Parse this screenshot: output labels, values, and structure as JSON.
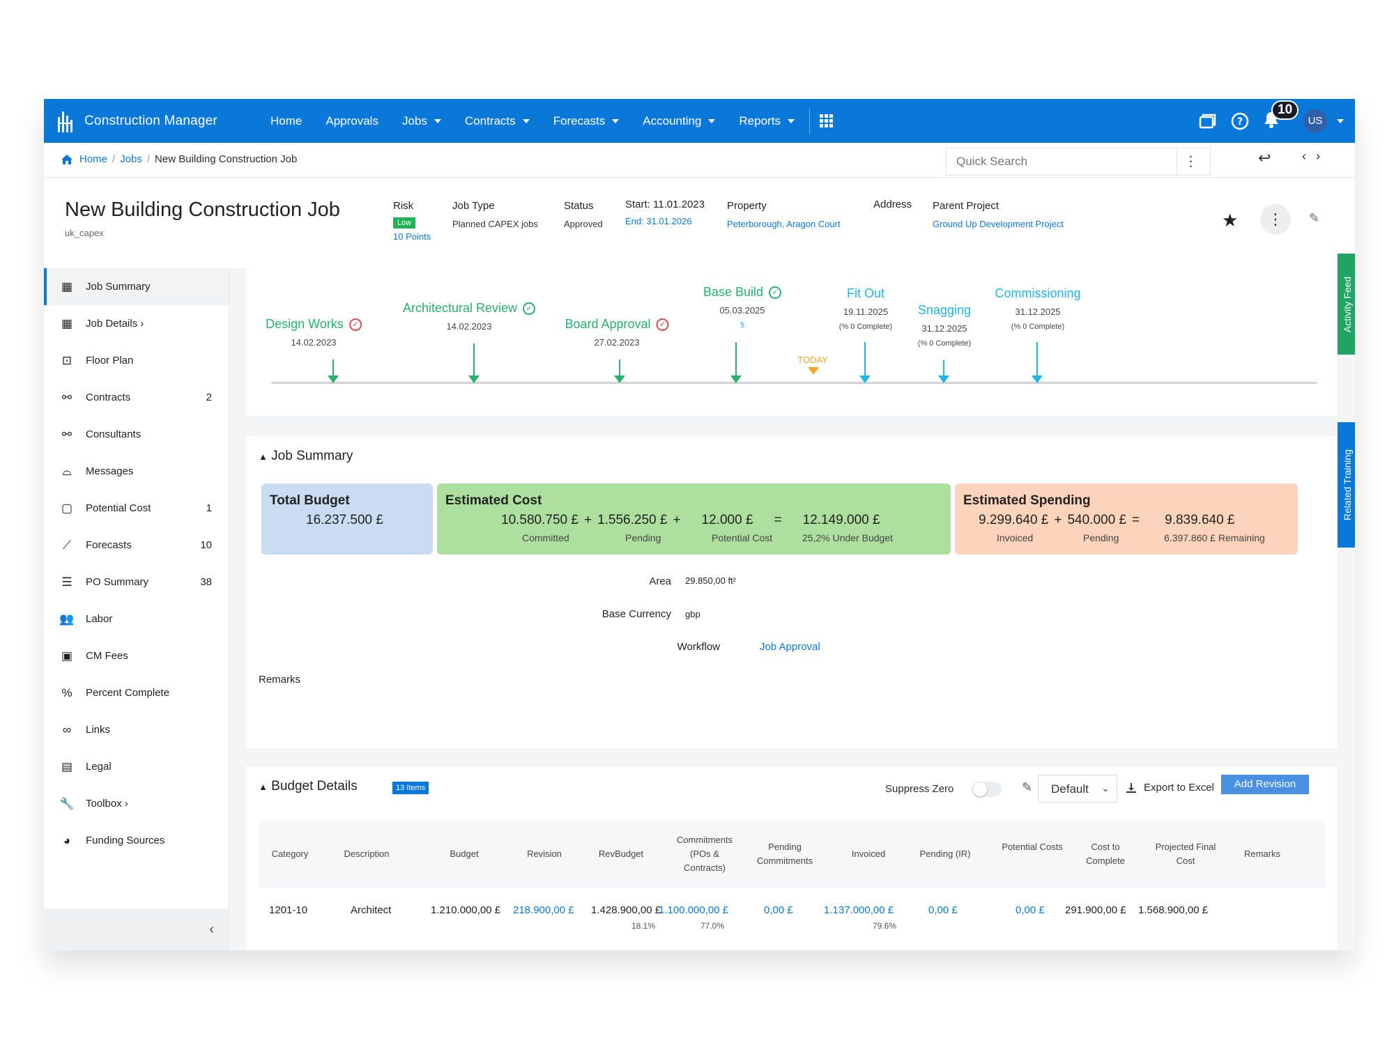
{
  "nav": {
    "brand": "Construction Manager",
    "items": [
      {
        "label": "Home",
        "dropdown": false
      },
      {
        "label": "Approvals",
        "dropdown": false
      },
      {
        "label": "Jobs",
        "dropdown": true
      },
      {
        "label": "Contracts",
        "dropdown": true
      },
      {
        "label": "Forecasts",
        "dropdown": true
      },
      {
        "label": "Accounting",
        "dropdown": true
      },
      {
        "label": "Reports",
        "dropdown": true
      }
    ],
    "notifications": "10",
    "user_initials": "US"
  },
  "breadcrumb": {
    "home": "Home",
    "jobs": "Jobs",
    "current": "New Building Construction Job"
  },
  "search": {
    "placeholder": "Quick Search"
  },
  "job": {
    "title": "New Building Construction Job",
    "code": "uk_capex",
    "risk_label": "Risk",
    "risk_level": "Low",
    "risk_points": "10 Points",
    "type_label": "Job Type",
    "type_value": "Planned CAPEX jobs",
    "status_label": "Status",
    "status_value": "Approved",
    "start": "Start: 11.01.2023",
    "end": "End: 31.01.2026",
    "property_label": "Property",
    "property_value": "Peterborough, Aragon Court",
    "address_label": "Address",
    "parent_label": "Parent Project",
    "parent_value": "Ground Up Development Project"
  },
  "sidebar": {
    "items": [
      {
        "label": "Job Summary",
        "icon": "building-icon",
        "count": ""
      },
      {
        "label": "Job Details ›",
        "icon": "building-icon",
        "count": ""
      },
      {
        "label": "Floor Plan",
        "icon": "floor-plan-icon",
        "count": ""
      },
      {
        "label": "Contracts",
        "icon": "handshake-icon",
        "count": "2"
      },
      {
        "label": "Consultants",
        "icon": "handshake-icon",
        "count": ""
      },
      {
        "label": "Messages",
        "icon": "inbox-icon",
        "count": ""
      },
      {
        "label": "Potential Cost",
        "icon": "clipboard-icon",
        "count": "1"
      },
      {
        "label": "Forecasts",
        "icon": "chart-icon",
        "count": "10"
      },
      {
        "label": "PO Summary",
        "icon": "list-icon",
        "count": "38"
      },
      {
        "label": "Labor",
        "icon": "users-icon",
        "count": ""
      },
      {
        "label": "CM Fees",
        "icon": "money-icon",
        "count": ""
      },
      {
        "label": "Percent Complete",
        "icon": "percent-icon",
        "count": ""
      },
      {
        "label": "Links",
        "icon": "link-icon",
        "count": ""
      },
      {
        "label": "Legal",
        "icon": "legal-doc-icon",
        "count": ""
      },
      {
        "label": "Toolbox ›",
        "icon": "wrench-icon",
        "count": ""
      },
      {
        "label": "Funding Sources",
        "icon": "pie-icon",
        "count": ""
      }
    ]
  },
  "timeline": {
    "milestones": [
      {
        "name": "Design Works",
        "date": "14.02.2023",
        "extra": "",
        "status": "red",
        "color": "#26b26a"
      },
      {
        "name": "Architectural Review",
        "date": "14.02.2023",
        "extra": "",
        "status": "green",
        "color": "#26b26a"
      },
      {
        "name": "Board Approval",
        "date": "27.02.2023",
        "extra": "",
        "status": "red",
        "color": "#26b26a"
      },
      {
        "name": "Base Build",
        "date": "05.03.2025",
        "extra": "5",
        "status": "green",
        "color": "#26b26a"
      },
      {
        "name": "Fit Out",
        "date": "19.11.2025",
        "extra": "(% 0 Complete)",
        "status": "",
        "color": "#1fb5e8"
      },
      {
        "name": "Snagging",
        "date": "31.12.2025",
        "extra": "(% 0 Complete)",
        "status": "",
        "color": "#1fb5e8"
      },
      {
        "name": "Commissioning",
        "date": "31.12.2025",
        "extra": "(% 0 Complete)",
        "status": "",
        "color": "#1fb5e8"
      }
    ],
    "today_label": "TODAY"
  },
  "side_tabs": {
    "activity": "Activity Feed",
    "training": "Related Training"
  },
  "summary": {
    "title": "Job Summary",
    "total_budget_label": "Total Budget",
    "total_budget": "16.237.500 £",
    "est_cost_label": "Estimated Cost",
    "est_committed": "10.580.750 £",
    "est_pending": "1.556.250 £",
    "est_potential": "12.000 £",
    "est_total": "12.149.000 £",
    "est_committed_label": "Committed",
    "est_pending_label": "Pending",
    "est_potential_label": "Potential Cost",
    "est_under": "25,2% Under Budget",
    "spend_label": "Estimated Spending",
    "spend_invoiced": "9.299.640 £",
    "spend_pending": "540.000 £",
    "spend_total": "9.839.640 £",
    "spend_invoiced_label": "Invoiced",
    "spend_pending_label": "Pending",
    "spend_remaining": "6.397.860 £ Remaining",
    "area_label": "Area",
    "area_value": "29.850,00 ft²",
    "currency_label": "Base Currency",
    "currency_value": "gbp",
    "workflow_label": "Workflow",
    "workflow_value": "Job Approval",
    "remarks_label": "Remarks"
  },
  "budget": {
    "title": "Budget Details",
    "items_badge": "13 Items",
    "suppress_zero": "Suppress Zero",
    "view_select": "Default",
    "export": "Export to Excel",
    "add_revision": "Add Revision",
    "headers": {
      "category": "Category",
      "description": "Description",
      "budget": "Budget",
      "revision": "Revision",
      "revbudget": "RevBudget",
      "commitments": "Commitments (POs & Contracts)",
      "pending_commitments": "Pending Commitments",
      "invoiced": "Invoiced",
      "pending_ir": "Pending (IR)",
      "potential_costs": "Potential Costs",
      "cost_to_complete": "Cost to Complete",
      "projected_final": "Projected Final Cost",
      "remarks": "Remarks"
    },
    "rows": [
      {
        "category": "1201-10",
        "description": "Architect",
        "budget": "1.210.000,00 £",
        "revision": "218.900,00 £",
        "revbudget": "1.428.900,00 £",
        "revbudget_pct": "18.1%",
        "commitments": "1.100.000,00 £",
        "commitments_pct": "77.0%",
        "pending_commitments": "0,00 £",
        "invoiced": "1.137.000,00 £",
        "invoiced_pct": "79.6%",
        "pending_ir": "0,00 £",
        "potential_costs": "0,00 £",
        "cost_to_complete": "291.900,00 £",
        "projected_final": "1.568.900,00 £"
      }
    ]
  },
  "colors": {
    "primary": "#0a78d9",
    "tile_blue": "#c9dcf1",
    "tile_green": "#addf9f",
    "tile_orange": "#fcd3bb",
    "activity_tab": "#21a463",
    "training_tab": "#0a78d9"
  }
}
